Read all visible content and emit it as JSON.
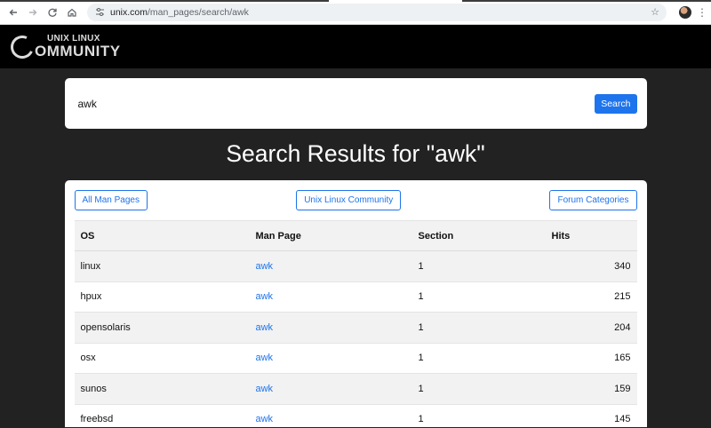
{
  "browser": {
    "url_host": "unix.com",
    "url_path": "/man_pages/search/awk",
    "icons": [
      "back-arrow-icon",
      "forward-arrow-icon",
      "reload-icon",
      "home-icon",
      "site-settings-icon",
      "star-icon",
      "profile-avatar",
      "more-menu-icon"
    ]
  },
  "site": {
    "logo_top": "UNIX LINUX",
    "logo_bottom": "OMMUNITY"
  },
  "search": {
    "value": "awk",
    "button_label": "Search"
  },
  "results": {
    "title": "Search Results for \"awk\"",
    "buttons": {
      "all_man_pages": "All Man Pages",
      "community": "Unix Linux Community",
      "forum_categories": "Forum Categories"
    },
    "columns": {
      "os": "OS",
      "man_page": "Man Page",
      "section": "Section",
      "hits": "Hits"
    },
    "rows": [
      {
        "os": "linux",
        "man_page": "awk",
        "section": "1",
        "hits": "340"
      },
      {
        "os": "hpux",
        "man_page": "awk",
        "section": "1",
        "hits": "215"
      },
      {
        "os": "opensolaris",
        "man_page": "awk",
        "section": "1",
        "hits": "204"
      },
      {
        "os": "osx",
        "man_page": "awk",
        "section": "1",
        "hits": "165"
      },
      {
        "os": "sunos",
        "man_page": "awk",
        "section": "1",
        "hits": "159"
      },
      {
        "os": "freebsd",
        "man_page": "awk",
        "section": "1",
        "hits": "145"
      }
    ]
  },
  "colors": {
    "accent": "#1e74ec",
    "page_bg": "#222222",
    "header_bg": "#000000"
  }
}
